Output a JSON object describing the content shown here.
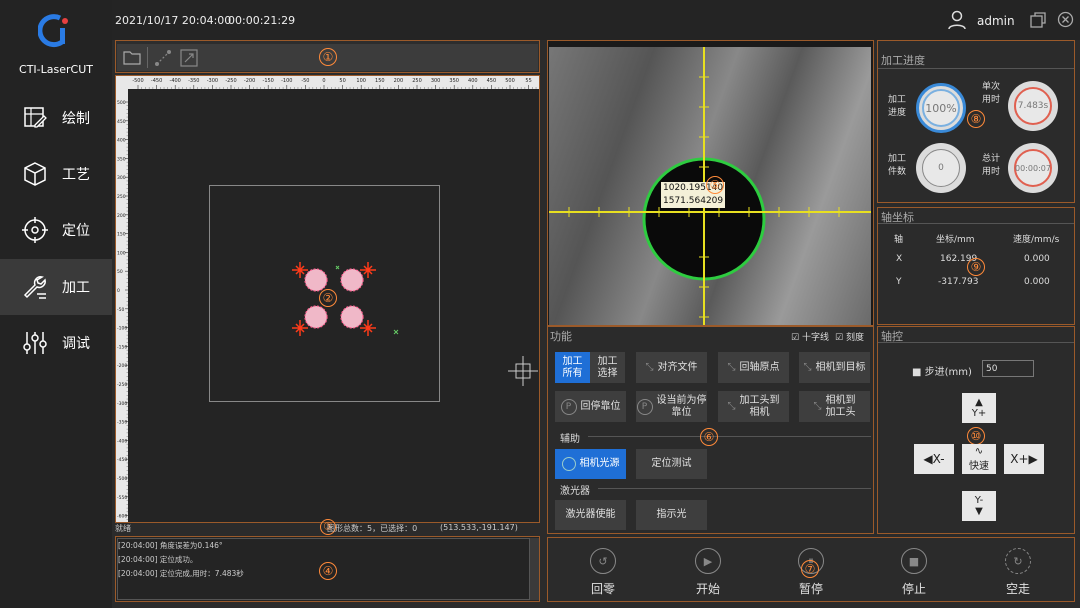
{
  "app": {
    "name": "CTI-LaserCUT",
    "logo_text": "Ci"
  },
  "nav": [
    {
      "label": "绘制",
      "icon": "draw-icon"
    },
    {
      "label": "工艺",
      "icon": "cube-icon"
    },
    {
      "label": "定位",
      "icon": "target-icon"
    },
    {
      "label": "加工",
      "icon": "wrench-icon"
    },
    {
      "label": "调试",
      "icon": "sliders-icon"
    }
  ],
  "topbar": {
    "datetime": "2021/10/17 20:04:00",
    "elapsed": "00:00:21:29",
    "user": "admin"
  },
  "ruler": {
    "top_ticks": [
      "-500",
      "-450",
      "-400",
      "-350",
      "-300",
      "-250",
      "-200",
      "-150",
      "-100",
      "-50",
      "0",
      "50",
      "100",
      "150",
      "200",
      "250",
      "300",
      "350",
      "400",
      "450",
      "500",
      "55"
    ],
    "left_ticks": [
      "500",
      "450",
      "400",
      "350",
      "300",
      "250",
      "200",
      "150",
      "100",
      "50",
      "0",
      "-50",
      "-100",
      "-150",
      "-200",
      "-250",
      "-300",
      "-350",
      "-400",
      "-450",
      "-500",
      "-550",
      "-600"
    ]
  },
  "status": {
    "left": "就绪",
    "shape_info": "图形总数：5，已选择：0",
    "coord": "(513.533,-191.147)"
  },
  "log": [
    "[20:04:00] 角度误差为0.146°",
    "[20:04:00] 定位成功。",
    "[20:04:00] 定位完成,用时：7.483秒"
  ],
  "camera": {
    "x": "1020.195140",
    "y": "1571.564209"
  },
  "func": {
    "title": "功能",
    "crosshair_label": "十字线",
    "scale_label": "刻度",
    "btns": [
      {
        "l1": "加工",
        "l2": "所有"
      },
      {
        "l1": "加工",
        "l2": "选择"
      },
      {
        "l1": "对齐文件",
        "l2": ""
      },
      {
        "l1": "回轴原点",
        "l2": ""
      },
      {
        "l1": "相机到目标",
        "l2": ""
      },
      {
        "l1": "回停靠位",
        "l2": ""
      },
      {
        "l1": "设当前为停",
        "l2": "靠位"
      },
      {
        "l1": "加工头到",
        "l2": "相机"
      },
      {
        "l1": "相机到",
        "l2": "加工头"
      }
    ],
    "aux_title": "辅助",
    "aux_btns": [
      "相机光源",
      "定位测试"
    ],
    "laser_title": "激光器",
    "laser_btns": [
      "激光器使能",
      "指示光"
    ]
  },
  "progress": {
    "title": "加工进度",
    "items": [
      {
        "label1": "加工",
        "label2": "进度",
        "value": "100%"
      },
      {
        "label1": "单次",
        "label2": "用时",
        "value": "7.483s"
      },
      {
        "label1": "加工",
        "label2": "件数",
        "value": "0"
      },
      {
        "label1": "总计",
        "label2": "用时",
        "value": "00:00:07"
      }
    ]
  },
  "axis": {
    "title": "轴坐标",
    "headers": [
      "轴",
      "坐标/mm",
      "速度/mm/s"
    ],
    "rows": [
      [
        "X",
        "162.199",
        "0.000"
      ],
      [
        "Y",
        "-317.793",
        "0.000"
      ]
    ]
  },
  "jog": {
    "title": "轴控",
    "step_label": "步进(mm)",
    "step_value": "50",
    "yplus": "Y+",
    "yminus": "Y-",
    "xminus": "X-",
    "xplus": "X+",
    "fast": "快速"
  },
  "controls": [
    "回零",
    "开始",
    "暂停",
    "停止",
    "空走"
  ],
  "markers": [
    "①",
    "②",
    "③",
    "④",
    "⑤",
    "⑥",
    "⑦",
    "⑧",
    "⑨",
    "⑩"
  ],
  "colors": {
    "accent": "#1f6fd6",
    "border": "#9b5a2a",
    "marker": "#ff8a3a",
    "crosshair": "#e8e020",
    "circle": "#2ecc40"
  }
}
